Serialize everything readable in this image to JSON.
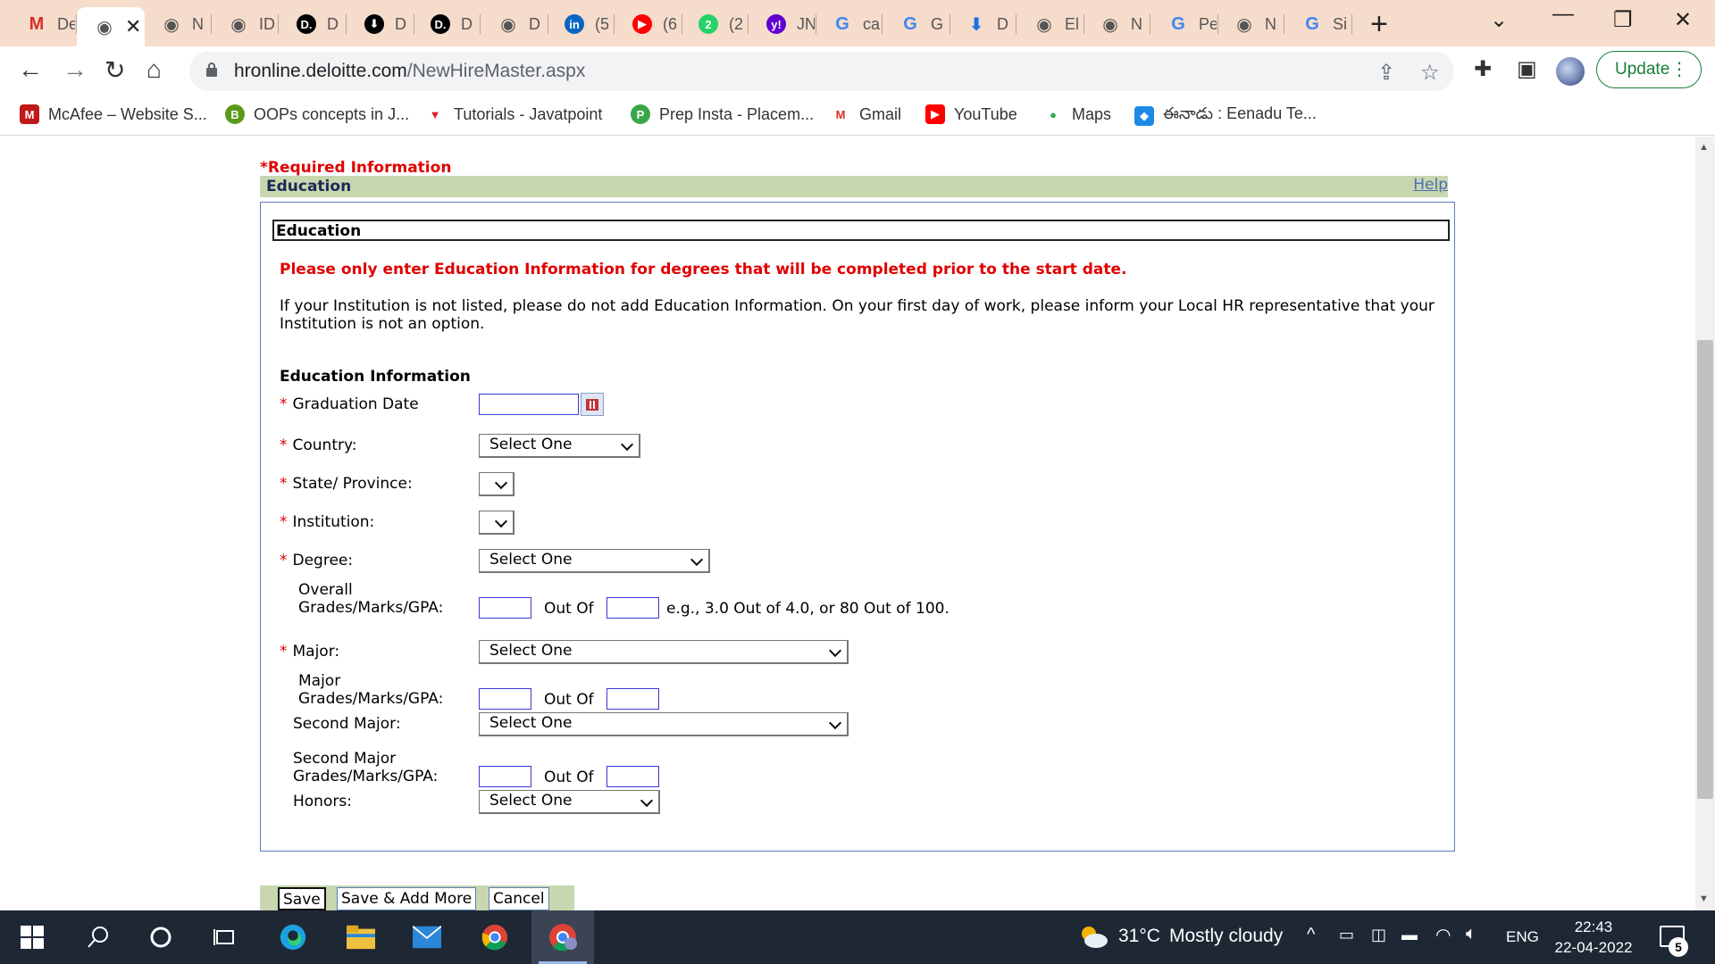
{
  "browser": {
    "tabs": [
      {
        "label": "De",
        "icon": "gmail-icon",
        "color": "#d93025"
      },
      {
        "label": "",
        "icon": "globe-icon",
        "color": "#555555",
        "active": true
      },
      {
        "label": "N",
        "icon": "globe-icon",
        "color": "#555555"
      },
      {
        "label": "ID",
        "icon": "globe-icon",
        "color": "#555555"
      },
      {
        "label": "D",
        "icon": "deloitte-icon",
        "color": "#000000"
      },
      {
        "label": "D",
        "icon": "download-icon",
        "color": "#000000"
      },
      {
        "label": "D",
        "icon": "deloitte-icon",
        "color": "#000000"
      },
      {
        "label": "D",
        "icon": "globe-icon",
        "color": "#555555"
      },
      {
        "label": "(5",
        "icon": "linkedin-icon",
        "color": "#0a66c2"
      },
      {
        "label": "(6",
        "icon": "youtube-icon",
        "color": "#ff0000"
      },
      {
        "label": "(2",
        "icon": "whatsapp-icon",
        "color": "#25d366"
      },
      {
        "label": "JN",
        "icon": "yahoo-icon",
        "color": "#6001d2"
      },
      {
        "label": "ca",
        "icon": "google-icon",
        "color": "#4285f4"
      },
      {
        "label": "G",
        "icon": "google-icon",
        "color": "#4285f4"
      },
      {
        "label": "D",
        "icon": "download-arrow-icon",
        "color": "#1a73e8"
      },
      {
        "label": "El",
        "icon": "globe-icon",
        "color": "#555555"
      },
      {
        "label": "N",
        "icon": "globe-icon",
        "color": "#555555"
      },
      {
        "label": "Pe",
        "icon": "google-icon",
        "color": "#4285f4"
      },
      {
        "label": "N",
        "icon": "globe-icon",
        "color": "#555555"
      },
      {
        "label": "Si",
        "icon": "google-icon",
        "color": "#4285f4"
      }
    ],
    "url_host": "hronline.deloitte.com",
    "url_path": "/NewHireMaster.aspx",
    "update_label": "Update",
    "bookmarks": [
      {
        "label": "McAfee – Website S...",
        "icon": "mcafee-icon",
        "color": "#c01818"
      },
      {
        "label": "OOPs concepts in J...",
        "icon": "b-badge-icon",
        "color": "#5c9a1b"
      },
      {
        "label": "Tutorials - Javatpoint",
        "icon": "javatpoint-icon",
        "color": "#e02020"
      },
      {
        "label": "Prep Insta - Placem...",
        "icon": "prepinsta-icon",
        "color": "#3aa64a"
      },
      {
        "label": "Gmail",
        "icon": "gmail-icon",
        "color": "#d93025"
      },
      {
        "label": "YouTube",
        "icon": "youtube-icon",
        "color": "#ff0000"
      },
      {
        "label": "Maps",
        "icon": "maps-icon",
        "color": "#34a853"
      },
      {
        "label": "ఈనాడు : Eenadu Te...",
        "icon": "eenadu-icon",
        "color": "#1e88e5"
      }
    ]
  },
  "form": {
    "required_info": "*Required Information",
    "section_title": "Education",
    "help": "Help",
    "panel_title": "Education",
    "warning": "Please only enter Education Information for degrees that will be completed prior to the start date.",
    "info": "If your Institution is not listed, please do not add Education Information. On your first day of work, please inform your Local HR representative that your Institution is not an option.",
    "subheading": "Education Information",
    "required_marker": "*",
    "fields": {
      "graduation_date": "Graduation Date",
      "country": "Country:",
      "state": "State/ Province:",
      "institution": "Institution:",
      "degree": "Degree:",
      "overall_line1": "Overall",
      "overall_line2": "Grades/Marks/GPA:",
      "major": "Major:",
      "major_grades_line1": "Major",
      "major_grades_line2": "Grades/Marks/GPA:",
      "second_major": "Second Major:",
      "second_major_grades_line1": "Second Major",
      "second_major_grades_line2": "Grades/Marks/GPA:",
      "honors": "Honors:"
    },
    "select_one": "Select One",
    "out_of": "Out Of",
    "example": "e.g., 3.0 Out of 4.0, or 80 Out of 100.",
    "buttons": {
      "save": "Save",
      "save_add": "Save & Add More",
      "cancel": "Cancel"
    }
  },
  "taskbar": {
    "weather_temp": "31°C",
    "weather_desc": "Mostly cloudy",
    "language": "ENG",
    "time": "22:43",
    "date": "22-04-2022",
    "notification_count": "5"
  }
}
